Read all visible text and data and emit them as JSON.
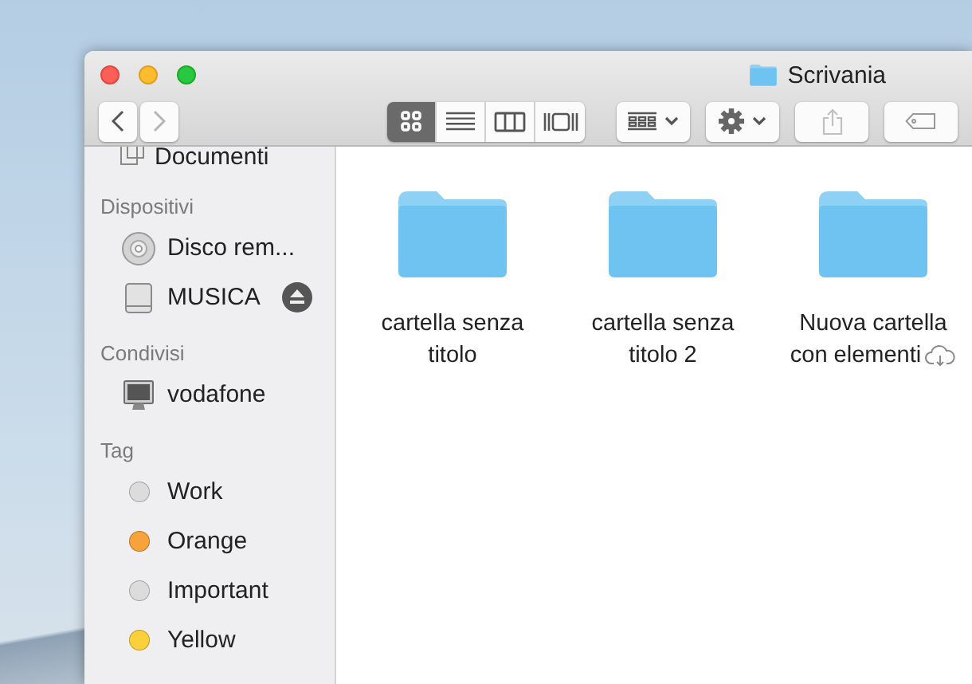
{
  "window": {
    "title": "Scrivania"
  },
  "toolbar": {
    "back": {
      "disabled": false
    },
    "forward": {
      "disabled": true
    },
    "view_modes": [
      {
        "kind": "icons",
        "selected": true
      },
      {
        "kind": "list",
        "selected": false
      },
      {
        "kind": "columns",
        "selected": false
      },
      {
        "kind": "gallery",
        "selected": false
      }
    ],
    "share": {
      "disabled": true
    }
  },
  "sidebar": {
    "partial_item": {
      "label": "Documenti"
    },
    "sections": [
      {
        "title": "Dispositivi",
        "items": [
          {
            "kind": "disc",
            "label": "Disco rem...",
            "eject": false
          },
          {
            "kind": "drive",
            "label": "MUSICA",
            "eject": true
          }
        ]
      },
      {
        "title": "Condivisi",
        "items": [
          {
            "kind": "computer",
            "label": "vodafone",
            "eject": false
          }
        ]
      },
      {
        "title": "Tag",
        "items": [
          {
            "kind": "tag",
            "label": "Work",
            "color": "#dcdcdc"
          },
          {
            "kind": "tag",
            "label": "Orange",
            "color": "#f7a23b"
          },
          {
            "kind": "tag",
            "label": "Important",
            "color": "#dcdcdc"
          },
          {
            "kind": "tag",
            "label": "Yellow",
            "color": "#fbd03b"
          }
        ]
      }
    ]
  },
  "files": [
    {
      "name": "cartella senza titolo",
      "icloud": false
    },
    {
      "name": "cartella senza titolo 2",
      "icloud": false
    },
    {
      "name": "Nuova cartella con elementi",
      "icloud": true
    }
  ]
}
